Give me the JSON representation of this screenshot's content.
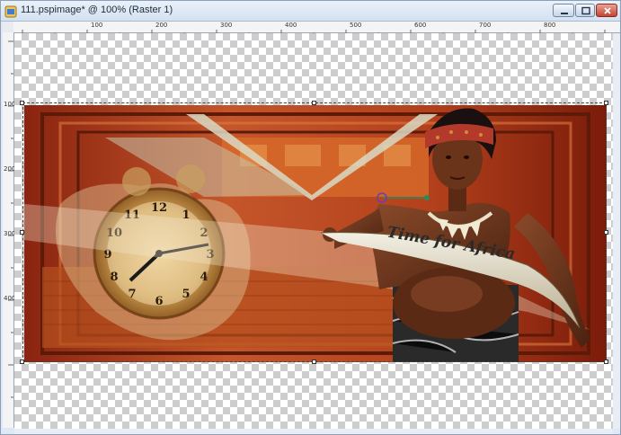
{
  "window": {
    "title": "111.pspimage* @ 100% (Raster 1)",
    "icons": {
      "app": "psp-document-icon",
      "minimize": "minimize-icon",
      "maximize": "maximize-icon",
      "close": "close-icon"
    }
  },
  "ruler": {
    "top_labels": [
      "100",
      "200",
      "300",
      "400",
      "500",
      "600",
      "700",
      "800"
    ],
    "left_labels": [
      "100",
      "200",
      "300",
      "400"
    ]
  },
  "image": {
    "caption": "Time for Africa",
    "zoom": "100%",
    "layer": "Raster 1"
  },
  "colors": {
    "artwork_red": "#9c2c12",
    "artwork_orange": "#d0642a",
    "selection_handle": "#2a8a5a"
  }
}
